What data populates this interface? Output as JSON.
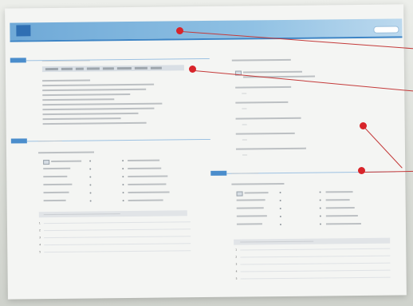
{
  "page": {
    "unit_tag": "",
    "title": "",
    "page_number_left": "",
    "page_number_right": ""
  },
  "markers": [
    {
      "name": "marker-title",
      "color": "#d8242a"
    },
    {
      "name": "marker-top-left",
      "color": "#d8242a"
    },
    {
      "name": "marker-right-middle",
      "color": "#d8242a"
    },
    {
      "name": "marker-right-section",
      "color": "#d8242a"
    }
  ],
  "colors": {
    "accent_blue": "#3c84c5",
    "title_bar": "#6fa9d7",
    "marker_red": "#d8242a",
    "paper": "#f4f5f3"
  },
  "note": ""
}
